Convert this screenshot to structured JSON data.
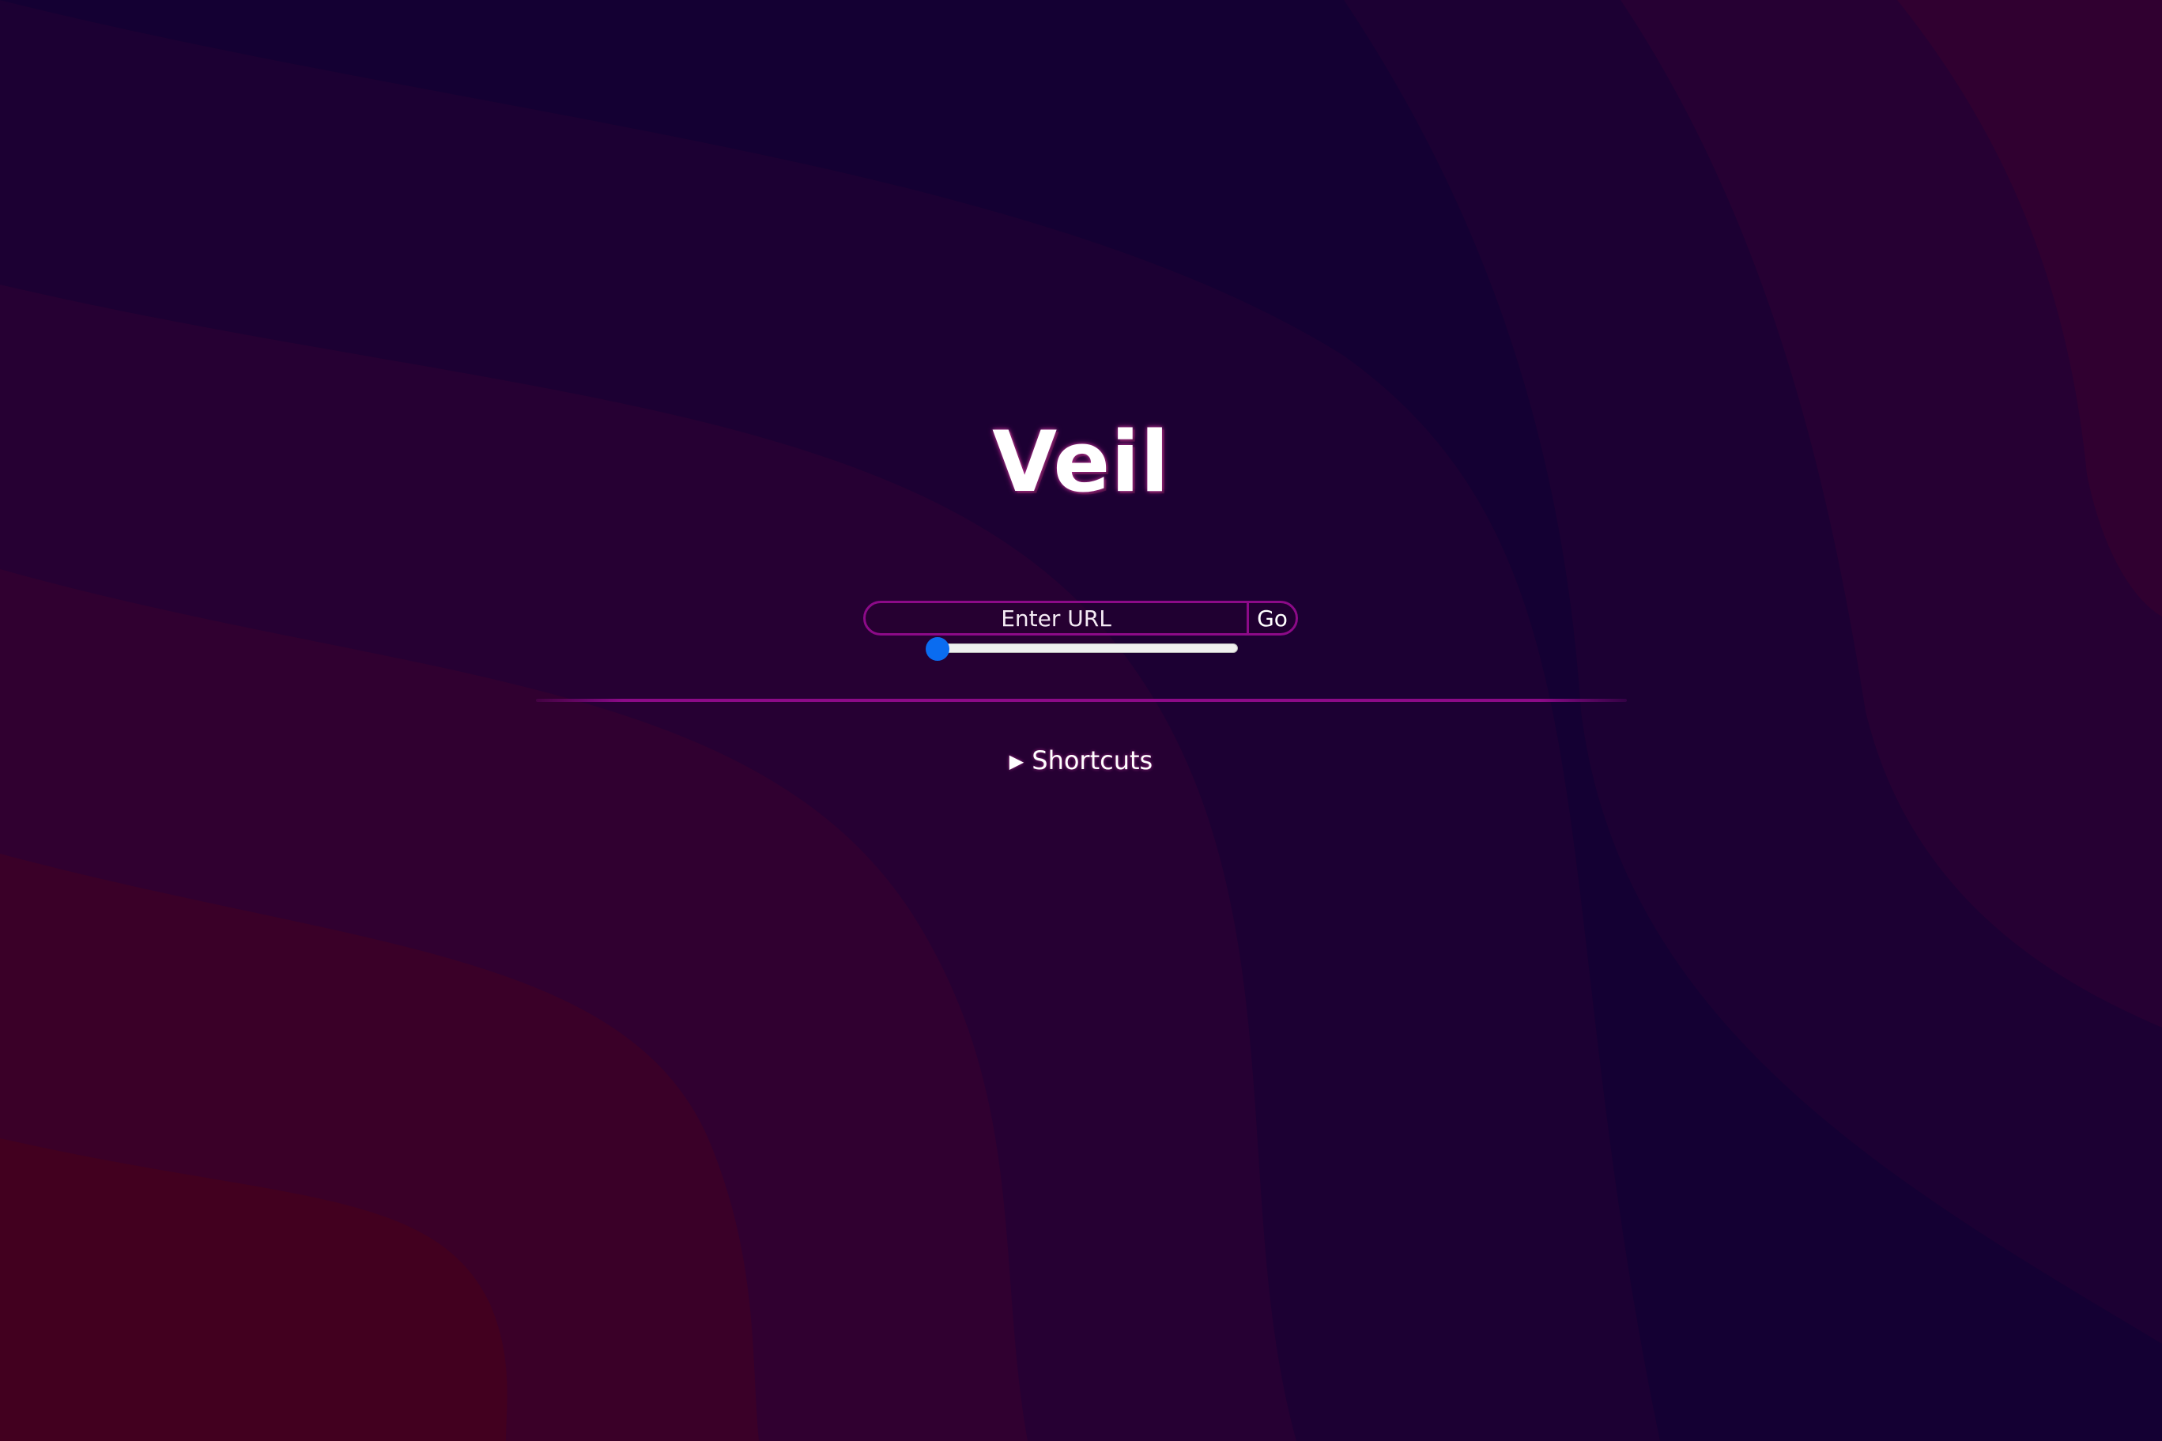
{
  "app": {
    "title": "Veil"
  },
  "search": {
    "placeholder": "Enter URL",
    "value": "",
    "go_label": "Go"
  },
  "slider": {
    "value_fraction": 0.0
  },
  "shortcuts": {
    "label": "Shortcuts",
    "expanded": false,
    "toggle_icon": "triangle-right-icon"
  },
  "colors": {
    "accent": "#8c0a88",
    "slider_blue": "#0a6cf0",
    "bg_band_1": "#140033",
    "bg_band_2": "#1c0033",
    "bg_band_3": "#260033",
    "bg_band_4": "#300030",
    "bg_band_5": "#3a0028",
    "bg_band_6": "#42001f",
    "bg_band_7": "#4a0018"
  }
}
